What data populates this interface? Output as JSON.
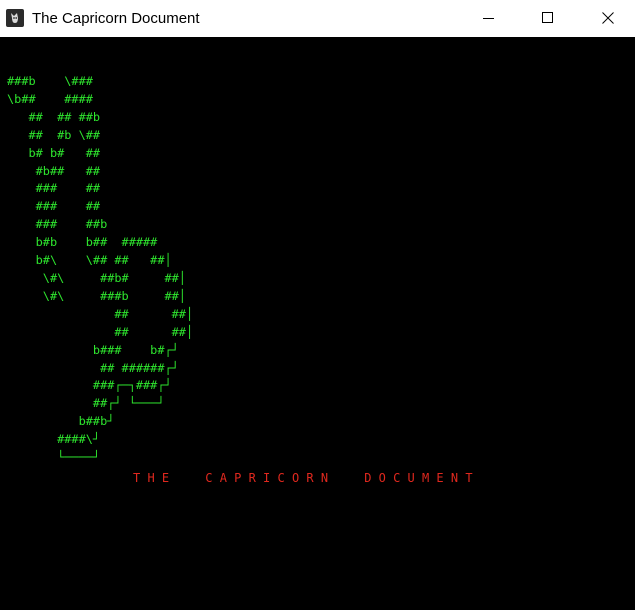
{
  "window": {
    "title": "The Capricorn Document",
    "icon": "app-icon",
    "controls": [
      "minimize-icon",
      "maximize-icon",
      "close-icon"
    ]
  },
  "console": {
    "background": "#000000",
    "art_color": "#2ee62e",
    "heading_color": "#e0281e",
    "art": "###b    \\###\n\\b##    ####\n   ##  ## ##b\n   ##  #b \\##\n   b# b#   ##\n    #b##   ##\n    ###    ##\n    ###    ##\n    ###    ##b\n    b#b    b##  #####\n    b#\\    \\## ##   ##│\n     \\#\\     ##b#     ##│\n     \\#\\     ###b     ##│\n               ##      ##│\n               ##      ##│\n            b###    b#┌┘\n             ## ######┌┘\n            ###┌─┐###┌┘\n            ##┌┘ └───┘\n          b##b┘\n       ####\\┘\n       └────┘",
    "heading": "T H E     C A P R I C O R N     D O C U M E N T"
  }
}
